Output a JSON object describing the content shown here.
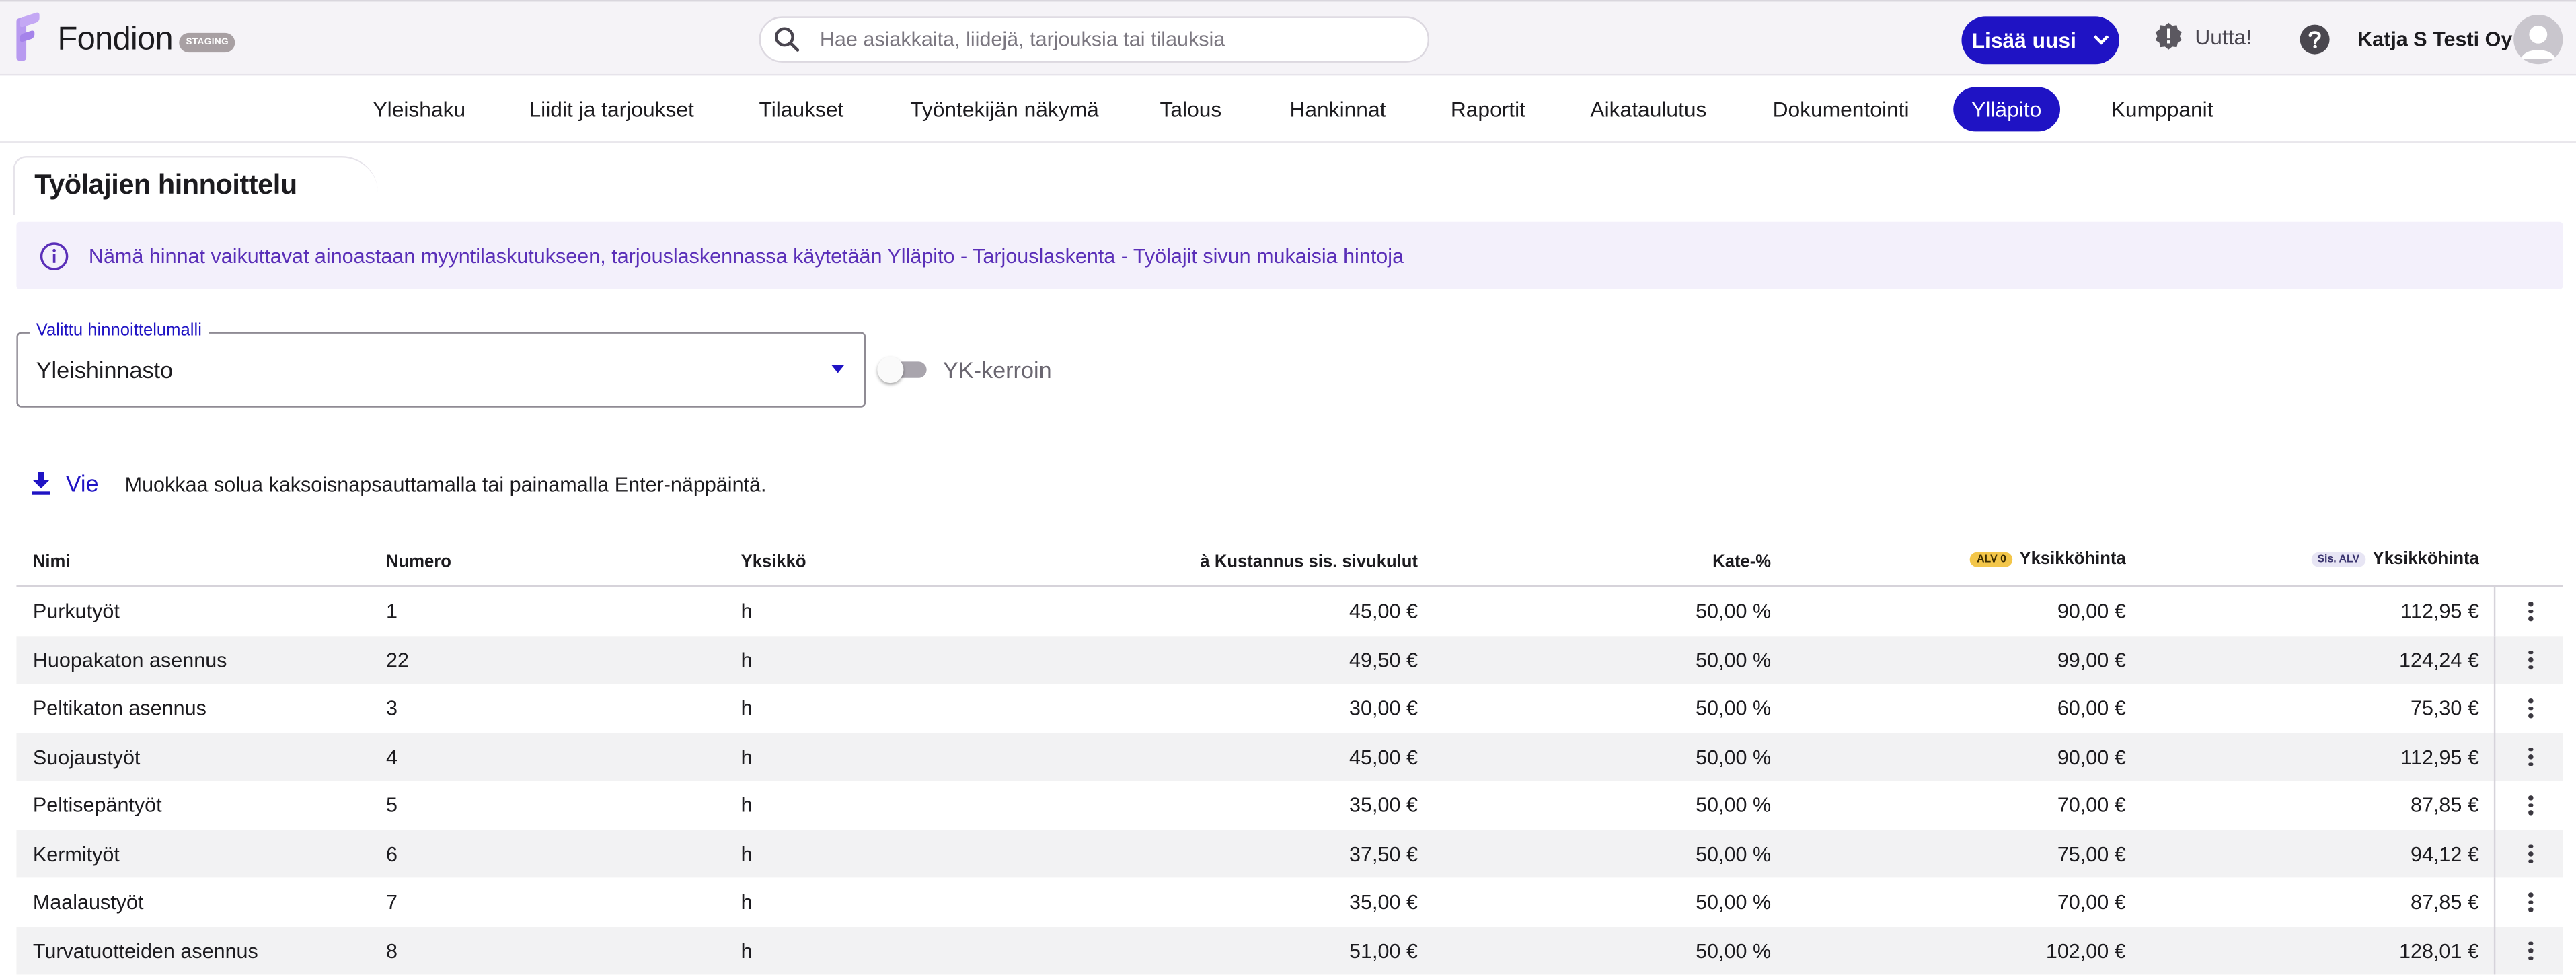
{
  "app": {
    "name": "Fondion",
    "env_badge": "STAGING",
    "search_placeholder": "Hae asiakkaita, liidejä, tarjouksia tai tilauksia",
    "add_new_label": "Lisää uusi",
    "news_label": "Uutta!",
    "company": "Katja S Testi Oy"
  },
  "nav": [
    {
      "label": "Yleishaku",
      "active": false
    },
    {
      "label": "Liidit ja tarjoukset",
      "active": false
    },
    {
      "label": "Tilaukset",
      "active": false
    },
    {
      "label": "Työntekijän näkymä",
      "active": false
    },
    {
      "label": "Talous",
      "active": false
    },
    {
      "label": "Hankinnat",
      "active": false
    },
    {
      "label": "Raportit",
      "active": false
    },
    {
      "label": "Aikataulutus",
      "active": false
    },
    {
      "label": "Dokumentointi",
      "active": false
    },
    {
      "label": "Ylläpito",
      "active": true
    },
    {
      "label": "Kumppanit",
      "active": false
    }
  ],
  "page": {
    "title": "Työlajien hinnoittelu",
    "info_text": "Nämä hinnat vaikuttavat ainoastaan myyntilaskutukseen, tarjouslaskennassa käytetään Ylläpito - Tarjouslaskenta - Työlajit sivun mukaisia hintoja",
    "select_label": "Valittu hinnoittelumalli",
    "select_value": "Yleishinnasto",
    "toggle_label": "YK-kerroin",
    "toggle_on": false,
    "export_label": "Vie",
    "edit_hint": "Muokkaa solua kaksoisnapsauttamalla tai painamalla Enter-näppäintä."
  },
  "table": {
    "headers": {
      "name": "Nimi",
      "number": "Numero",
      "unit": "Yksikkö",
      "cost": "à Kustannus sis. sivukulut",
      "margin": "Kate-%",
      "badge_alv0": "ALV 0",
      "unit_price_alv0": "Yksikköhinta",
      "badge_sis_alv": "Sis. ALV",
      "unit_price_vat": "Yksikköhinta"
    },
    "rows": [
      {
        "name": "Purkutyöt",
        "number": "1",
        "unit": "h",
        "cost": "45,00 €",
        "margin": "50,00 %",
        "price0": "90,00 €",
        "price": "112,95 €"
      },
      {
        "name": "Huopakaton asennus",
        "number": "22",
        "unit": "h",
        "cost": "49,50 €",
        "margin": "50,00 %",
        "price0": "99,00 €",
        "price": "124,24 €"
      },
      {
        "name": "Peltikaton asennus",
        "number": "3",
        "unit": "h",
        "cost": "30,00 €",
        "margin": "50,00 %",
        "price0": "60,00 €",
        "price": "75,30 €"
      },
      {
        "name": "Suojaustyöt",
        "number": "4",
        "unit": "h",
        "cost": "45,00 €",
        "margin": "50,00 %",
        "price0": "90,00 €",
        "price": "112,95 €"
      },
      {
        "name": "Peltisepäntyöt",
        "number": "5",
        "unit": "h",
        "cost": "35,00 €",
        "margin": "50,00 %",
        "price0": "70,00 €",
        "price": "87,85 €"
      },
      {
        "name": "Kermityöt",
        "number": "6",
        "unit": "h",
        "cost": "37,50 €",
        "margin": "50,00 %",
        "price0": "75,00 €",
        "price": "94,12 €"
      },
      {
        "name": "Maalaustyöt",
        "number": "7",
        "unit": "h",
        "cost": "35,00 €",
        "margin": "50,00 %",
        "price0": "70,00 €",
        "price": "87,85 €"
      },
      {
        "name": "Turvatuotteiden asennus",
        "number": "8",
        "unit": "h",
        "cost": "51,00 €",
        "margin": "50,00 %",
        "price0": "102,00 €",
        "price": "128,01 €"
      }
    ]
  },
  "colors": {
    "primary": "#1f13c4",
    "info_bg": "#f3f0fb",
    "info_text": "#5a2fb8",
    "badge_alv0": "#f3c64a"
  }
}
